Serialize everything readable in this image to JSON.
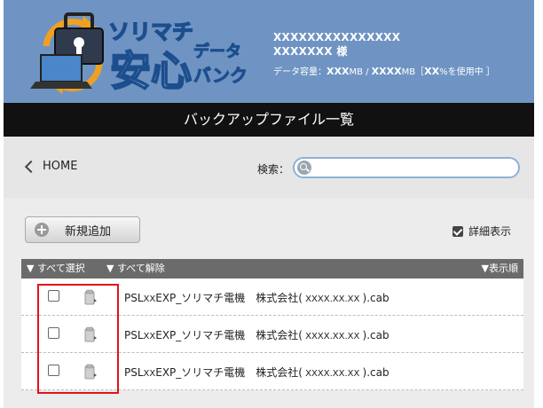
{
  "logo": {
    "brand": "ソリマチ",
    "main": "安心",
    "sub_top": "データ",
    "sub_bottom": "バンク"
  },
  "user": {
    "line1": "XXXXXXXXXXXXXXX",
    "line2": "XXXXXXX 様",
    "storage_prefix": "データ容量：",
    "used": "XXX",
    "used_unit": "MB / ",
    "total": "XXXX",
    "total_unit": "MB［",
    "percent": "XX",
    "percent_suffix": "%を使用中 ］"
  },
  "title": "バックアップファイル一覧",
  "nav": {
    "home": "HOME",
    "search_label": "検索：",
    "search_value": ""
  },
  "actions": {
    "add": "新規追加",
    "detail": "詳細表示"
  },
  "list_header": {
    "select_all": "▼ すべて選択",
    "deselect_all": "▼ すべて解除",
    "sort": "▼表示順"
  },
  "files": [
    {
      "prefix": "PSL",
      "mid": "XX",
      "name": "EXP_ソリマチ電機　株式会社(",
      "date": " XXXX.XX.XX ",
      "ext": ").cab"
    },
    {
      "prefix": "PSL",
      "mid": "XX",
      "name": "EXP_ソリマチ電機　株式会社(",
      "date": " XXXX.XX.XX ",
      "ext": ").cab"
    },
    {
      "prefix": "PSL",
      "mid": "XX",
      "name": "EXP_ソリマチ電機　株式会社(",
      "date": " XXXX.XX.XX ",
      "ext": ").cab"
    }
  ],
  "colors": {
    "header_bg": "#6f94c3",
    "title_bg": "#111111",
    "list_header_bg": "#6b6b6b",
    "highlight": "#e1131b",
    "search_border": "#8fb1d8"
  },
  "icons": {
    "logo": "padlock-laptop-sync-icon",
    "home": "chevron-left-icon",
    "search": "search-icon",
    "add": "plus-icon",
    "detail": "checkbox-checked-icon",
    "file": "archive-file-icon"
  }
}
